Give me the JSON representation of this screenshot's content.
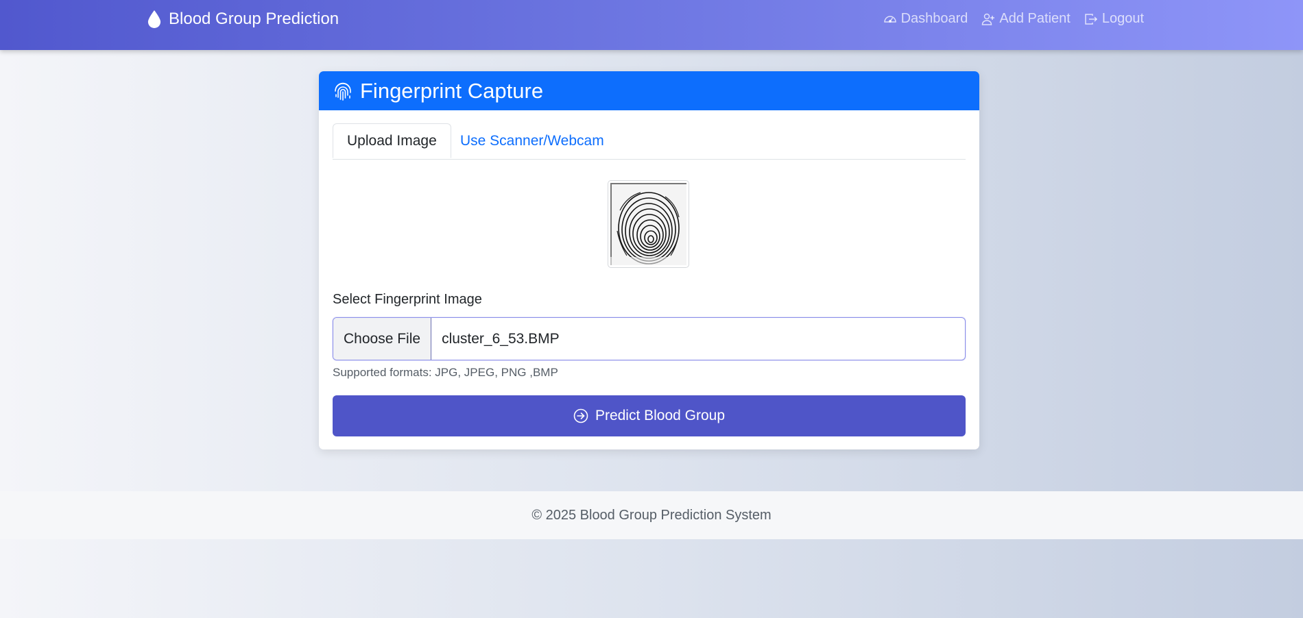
{
  "navbar": {
    "brand_icon": "droplet-icon",
    "brand_label": "Blood Group Prediction",
    "links": [
      {
        "label": "Dashboard",
        "icon": "speedometer-icon"
      },
      {
        "label": "Add Patient",
        "icon": "person-plus-icon"
      },
      {
        "label": "Logout",
        "icon": "box-arrow-right-icon"
      }
    ]
  },
  "card": {
    "title": "Fingerprint Capture",
    "title_icon": "fingerprint-icon",
    "tabs": [
      {
        "label": "Upload Image",
        "active": true
      },
      {
        "label": "Use Scanner/Webcam",
        "active": false
      }
    ],
    "preview_image": "fingerprint-preview",
    "field_label": "Select Fingerprint Image",
    "file_input": {
      "button_label": "Choose File",
      "file_name": "cluster_6_53.BMP"
    },
    "help_text": "Supported formats: JPG, JPEG, PNG ,BMP",
    "submit_label": "Predict Blood Group",
    "submit_icon": "arrow-right-circle-icon"
  },
  "footer": {
    "text": "© 2025 Blood Group Prediction System"
  },
  "colors": {
    "navbar_start": "#5158ce",
    "navbar_end": "#8e95f8",
    "card_header": "#0d6efd",
    "primary_button": "#4f55c8",
    "tab_link": "#0d6efd"
  }
}
